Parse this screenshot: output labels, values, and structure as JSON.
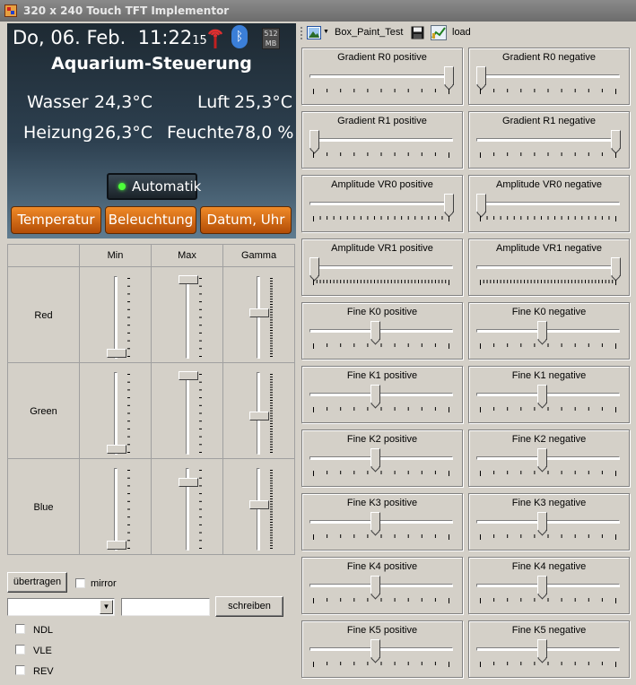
{
  "window": {
    "title": "320 x 240 Touch TFT Implementor"
  },
  "tft": {
    "date": "Do, 06. Feb.",
    "time": "11:22",
    "seconds": "15",
    "mem_top": "512",
    "mem_bottom": "MB",
    "title": "Aquarium-Steuerung",
    "wasser_label": "Wasser",
    "wasser_value": "24,3°C",
    "luft_label": "Luft",
    "luft_value": "25,3°C",
    "heizung_label": "Heizung",
    "heizung_value": "26,3°C",
    "feuchte_label": "Feuchte",
    "feuchte_value": "78,0 %",
    "auto_button": "Automatik",
    "buttons": [
      "Temperatur",
      "Beleuchtung",
      "Datum, Uhr"
    ],
    "colors": {
      "orange": "#e67818",
      "led": "#4dff3a",
      "bluetooth": "#3b7fd8"
    }
  },
  "rgb_grid": {
    "headers": [
      "Min",
      "Max",
      "Gamma"
    ],
    "rows": [
      {
        "label": "Red",
        "min": 0,
        "max": 1.0,
        "gamma": 0.55
      },
      {
        "label": "Green",
        "min": 0,
        "max": 1.0,
        "gamma": 0.45
      },
      {
        "label": "Blue",
        "min": 0,
        "max": 0.85,
        "gamma": 0.55
      }
    ]
  },
  "controls": {
    "transfer_button": "übertragen",
    "mirror_label": "mirror",
    "write_button": "schreiben",
    "checkboxes": [
      "NDL",
      "VLE",
      "REV"
    ]
  },
  "toolbar": {
    "name": "Box_Paint_Test",
    "load_label": "load"
  },
  "sliders": [
    {
      "left": "Gradient R0 positive",
      "left_value": 1.0,
      "right": "Gradient R0 negative",
      "right_value": 0.0,
      "ticks": 10
    },
    {
      "left": "Gradient R1 positive",
      "left_value": 0.0,
      "right": "Gradient R1 negative",
      "right_value": 1.0,
      "ticks": 10
    },
    {
      "left": "Amplitude VR0 positive",
      "left_value": 1.0,
      "right": "Amplitude VR0 negative",
      "right_value": 0.0,
      "ticks": 20
    },
    {
      "left": "Amplitude VR1 positive",
      "left_value": 0.0,
      "right": "Amplitude VR1 negative",
      "right_value": 1.0,
      "ticks": 40
    },
    {
      "left": "Fine  K0 positive",
      "left_value": 0.45,
      "right": "Fine  K0 negative",
      "right_value": 0.45,
      "ticks": 10
    },
    {
      "left": "Fine  K1 positive",
      "left_value": 0.45,
      "right": "Fine  K1 negative",
      "right_value": 0.45,
      "ticks": 10
    },
    {
      "left": "Fine  K2 positive",
      "left_value": 0.45,
      "right": "Fine  K2 negative",
      "right_value": 0.45,
      "ticks": 10
    },
    {
      "left": "Fine  K3 positive",
      "left_value": 0.45,
      "right": "Fine  K3 negative",
      "right_value": 0.45,
      "ticks": 10
    },
    {
      "left": "Fine  K4 positive",
      "left_value": 0.45,
      "right": "Fine  K4 negative",
      "right_value": 0.45,
      "ticks": 10
    },
    {
      "left": "Fine  K5 positive",
      "left_value": 0.45,
      "right": "Fine  K5 negative",
      "right_value": 0.45,
      "ticks": 10
    }
  ]
}
